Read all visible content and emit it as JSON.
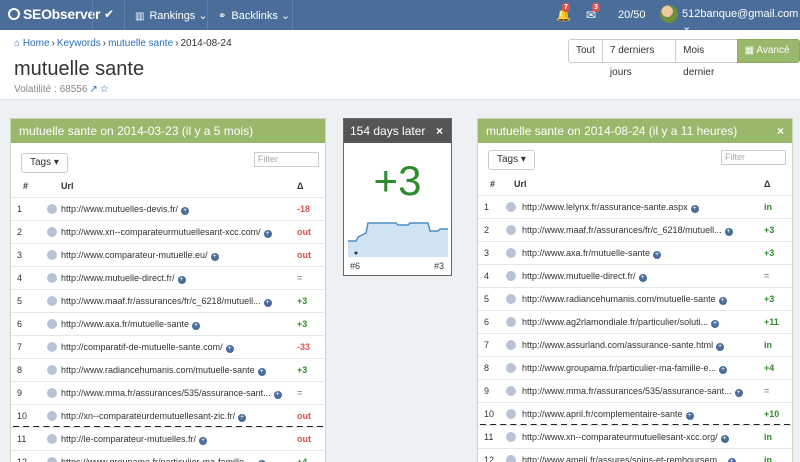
{
  "nav": {
    "logo": "SEObserver",
    "check": "✔",
    "rankings": "Rankings ⌄",
    "backlinks": "Backlinks ⌄",
    "notif1": "7",
    "notif2": "3",
    "count": "20/50",
    "user": "512banque@gmail.com ⌄"
  },
  "breadcrumb": {
    "home": "Home",
    "keywords": "Keywords",
    "keyword": "mutuelle sante",
    "date": "2014-08-24"
  },
  "page": {
    "title": "mutuelle sante",
    "volatility_label": "Volatilité : 68556"
  },
  "range_buttons": {
    "all": "Tout",
    "seven": "7 derniers jours",
    "month": "Mois dernier",
    "advanced": "Avancé ⌄"
  },
  "left": {
    "header": "mutuelle sante on  2014-03-23 (il y a 5 mois)",
    "tags": "Tags ▾",
    "filter_placeholder": "Filter",
    "col_num": "#",
    "col_url": "Url",
    "col_delta": "Δ",
    "rows": [
      {
        "n": "1",
        "url": "http://www.mutuelles-devis.fr/",
        "d": "-18",
        "c": "#d9534f"
      },
      {
        "n": "2",
        "url": "http://www.xn--comparateurmutuellesant-xcc.com/",
        "d": "out",
        "c": "#d9534f"
      },
      {
        "n": "3",
        "url": "http://www.comparateur-mutuelle.eu/",
        "d": "out",
        "c": "#d9534f"
      },
      {
        "n": "4",
        "url": "http://www.mutuelle-direct.fr/",
        "d": "=",
        "c": "#999"
      },
      {
        "n": "5",
        "url": "http://www.maaf.fr/assurances/fr/c_6218/mutuell...",
        "d": "+3",
        "c": "#2e8b2e"
      },
      {
        "n": "6",
        "url": "http://www.axa.fr/mutuelle-sante",
        "d": "+3",
        "c": "#2e8b2e"
      },
      {
        "n": "7",
        "url": "http://comparatif-de-mutuelle-sante.com/",
        "d": "-33",
        "c": "#d9534f"
      },
      {
        "n": "8",
        "url": "http://www.radiancehumanis.com/mutuelle-sante",
        "d": "+3",
        "c": "#2e8b2e"
      },
      {
        "n": "9",
        "url": "http://www.mma.fr/assurances/535/assurance-sant...",
        "d": "=",
        "c": "#999"
      },
      {
        "n": "10",
        "url": "http://xn--comparateurdemutuellesant-zic.fr/",
        "d": "out",
        "c": "#d9534f"
      },
      {
        "n": "11",
        "url": "http://le-comparateur-mutuelles.fr/",
        "d": "out",
        "c": "#d9534f"
      },
      {
        "n": "12",
        "url": "https://www.groupama.fr/particulier-ma-famille-...",
        "d": "+4",
        "c": "#2e8b2e"
      }
    ]
  },
  "middle": {
    "header": "154 days later",
    "value": "+3",
    "from": "#6",
    "to": "#3"
  },
  "right": {
    "header": "mutuelle sante on 2014-08-24 (il y a 11 heures)",
    "tags": "Tags ▾",
    "filter_placeholder": "Filter",
    "col_num": "#",
    "col_url": "Url",
    "col_delta": "Δ",
    "rows": [
      {
        "n": "1",
        "url": "http://www.lelynx.fr/assurance-sante.aspx",
        "d": "in",
        "c": "#2e8b2e"
      },
      {
        "n": "2",
        "url": "http://www.maaf.fr/assurances/fr/c_6218/mutuell...",
        "d": "+3",
        "c": "#2e8b2e"
      },
      {
        "n": "3",
        "url": "http://www.axa.fr/mutuelle-sante",
        "d": "+3",
        "c": "#2e8b2e"
      },
      {
        "n": "4",
        "url": "http://www.mutuelle-direct.fr/",
        "d": "=",
        "c": "#999"
      },
      {
        "n": "5",
        "url": "http://www.radiancehumanis.com/mutuelle-sante",
        "d": "+3",
        "c": "#2e8b2e"
      },
      {
        "n": "6",
        "url": "http://www.ag2rlamondiale.fr/particulier/soluti...",
        "d": "+11",
        "c": "#2e8b2e"
      },
      {
        "n": "7",
        "url": "http://www.assurland.com/assurance-sante.html",
        "d": "in",
        "c": "#2e8b2e"
      },
      {
        "n": "8",
        "url": "http://www.groupama.fr/particulier-ma-famille-e...",
        "d": "+4",
        "c": "#2e8b2e"
      },
      {
        "n": "9",
        "url": "http://www.mma.fr/assurances/535/assurance-sant...",
        "d": "=",
        "c": "#999"
      },
      {
        "n": "10",
        "url": "http://www.april.fr/complementaire-sante",
        "d": "+10",
        "c": "#2e8b2e"
      },
      {
        "n": "11",
        "url": "http://www.xn--comparateurmutuellesant-xcc.org/",
        "d": "in",
        "c": "#2e8b2e"
      },
      {
        "n": "12",
        "url": "http://www.ameli.fr/assures/soins-et-remboursem...",
        "d": "in",
        "c": "#2e8b2e"
      }
    ]
  }
}
